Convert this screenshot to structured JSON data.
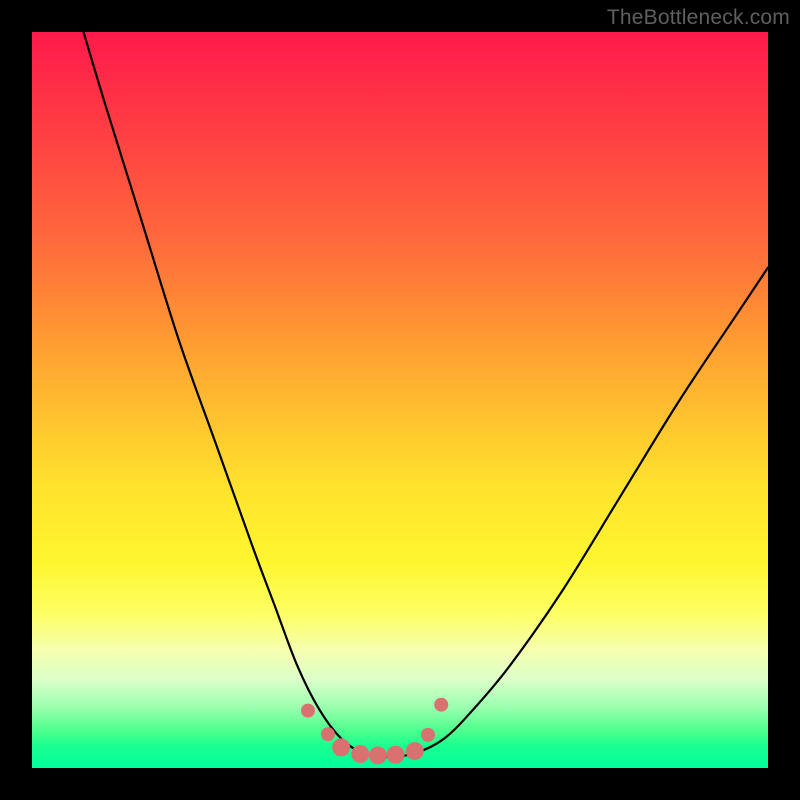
{
  "watermark": "TheBottleneck.com",
  "chart_data": {
    "type": "line",
    "title": "",
    "xlabel": "",
    "ylabel": "",
    "xlim": [
      0,
      100
    ],
    "ylim": [
      0,
      100
    ],
    "series": [
      {
        "name": "bottleneck-curve",
        "x": [
          7,
          10,
          15,
          20,
          25,
          30,
          33,
          36,
          39,
          42,
          45,
          48,
          52,
          56,
          60,
          65,
          72,
          80,
          88,
          96,
          100
        ],
        "y": [
          100,
          90,
          74,
          58,
          44,
          30,
          22,
          14,
          8,
          4,
          2,
          1.5,
          2,
          4,
          8,
          14,
          24,
          37,
          50,
          62,
          68
        ]
      }
    ],
    "markers": {
      "name": "highlight-dots",
      "color": "#d87170",
      "x": [
        37.5,
        40.2,
        42.0,
        44.6,
        47.0,
        49.4,
        52.0,
        53.8,
        55.6
      ],
      "y": [
        7.8,
        4.6,
        2.8,
        1.9,
        1.7,
        1.8,
        2.3,
        4.5,
        8.6
      ]
    },
    "background_gradient": {
      "top": "#ff1a4b",
      "mid": "#fff62f",
      "bottom": "#00ff9b"
    }
  }
}
